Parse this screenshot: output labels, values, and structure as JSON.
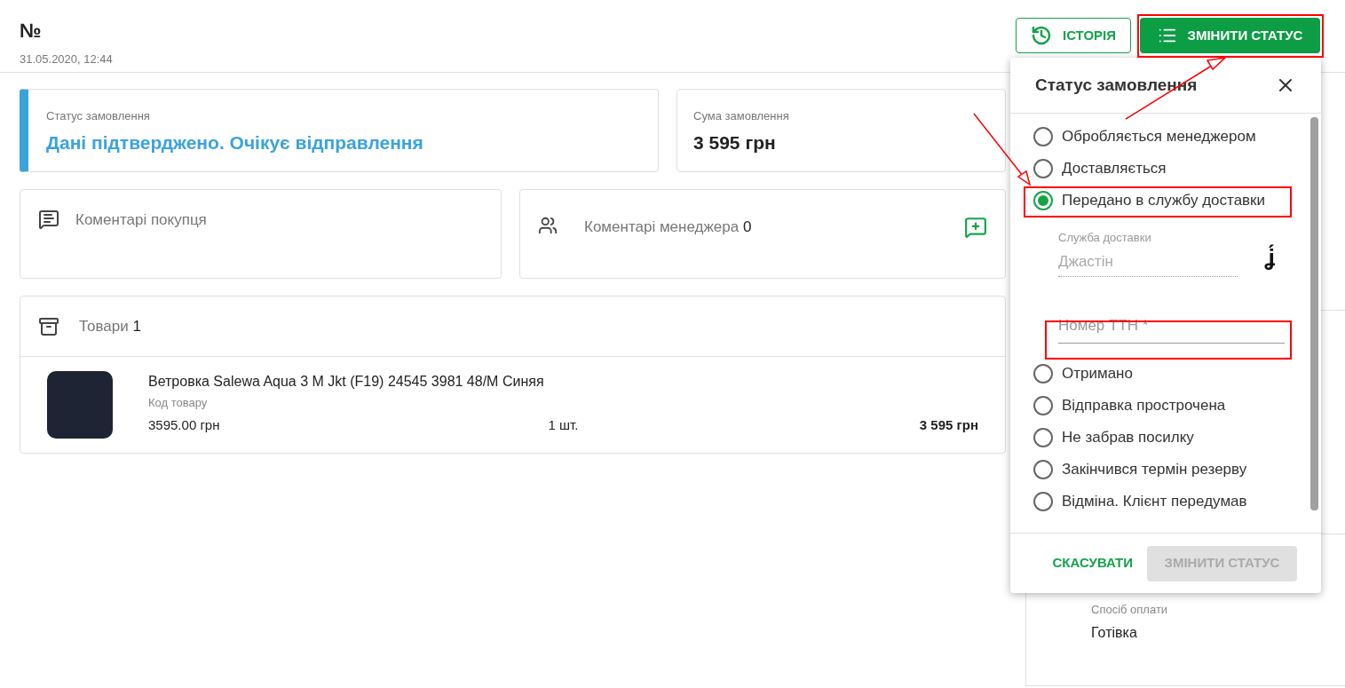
{
  "header": {
    "title": "№",
    "date": "31.05.2020, 12:44",
    "history_button": "ІСТОРІЯ",
    "change_status_button": "ЗМІНИТИ СТАТУС"
  },
  "status_card": {
    "label": "Статус замовлення",
    "value": "Дані підтверджено. Очікує відправлення"
  },
  "sum_card": {
    "label": "Сума замовлення",
    "value": "3 595 грн"
  },
  "buyer_comments": {
    "label": "Коментарі покупця"
  },
  "manager_comments": {
    "label": "Коментарі менеджера",
    "count": "0"
  },
  "products": {
    "label": "Товари",
    "count": "1",
    "items": [
      {
        "name": "Ветровка Salewa Aqua 3 M Jkt (F19) 24545 3981 48/M Синяя",
        "code_label": "Код товару",
        "price": "3595.00 грн",
        "quantity": "1 шт.",
        "total": "3 595 грн"
      }
    ]
  },
  "sidebar": {
    "payment_label": "Спосіб оплати",
    "payment_value": "Готівка"
  },
  "popup": {
    "title": "Статус замовлення",
    "options": [
      {
        "label": "Обробляється менеджером",
        "selected": false
      },
      {
        "label": "Доставляється",
        "selected": false
      },
      {
        "label": "Передано в службу доставки",
        "selected": true
      },
      {
        "label": "Отримано",
        "selected": false
      },
      {
        "label": "Відправка прострочена",
        "selected": false
      },
      {
        "label": "Не забрав посилку",
        "selected": false
      },
      {
        "label": "Закінчився термін резерву",
        "selected": false
      },
      {
        "label": "Відміна. Клієнт передумав",
        "selected": false
      }
    ],
    "delivery": {
      "label": "Служба доставки",
      "value": "Джастін",
      "mark": "ʝ́"
    },
    "ttn": {
      "placeholder": "Номер ТТН *"
    },
    "cancel_button": "СКАСУВАТИ",
    "submit_button": {
      "label": "ЗМІНИТИ СТАТУС",
      "disabled": true
    }
  }
}
